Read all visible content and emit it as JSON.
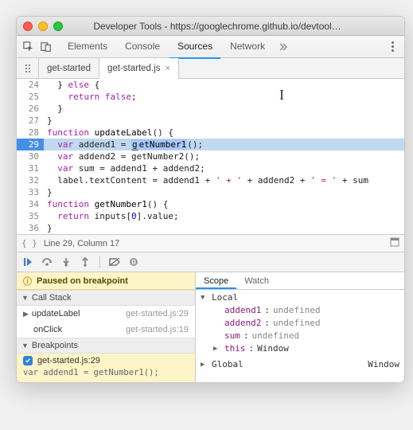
{
  "window": {
    "title": "Developer Tools - https://googlechrome.github.io/devtool…"
  },
  "panel_tabs": [
    "Elements",
    "Console",
    "Sources",
    "Network"
  ],
  "panel_active_index": 2,
  "file_tabs": [
    {
      "label": "get-started",
      "active": false
    },
    {
      "label": "get-started.js",
      "active": true
    }
  ],
  "code": {
    "first_line": 24,
    "current_line": 29,
    "lines": [
      {
        "n": 24,
        "html": "  } <span class='kw'>else</span> {"
      },
      {
        "n": 25,
        "html": "    <span class='kw'>return</span> <span class='kw'>false</span>;"
      },
      {
        "n": 26,
        "html": "  }"
      },
      {
        "n": 27,
        "html": "}"
      },
      {
        "n": 28,
        "html": "<span class='kw'>function</span> <span class='fn'>updateLabel</span>() {"
      },
      {
        "n": 29,
        "html": "  <span class='kw'>var</span> addend1 = <span class='selected underline'>g</span><span class='selected'>etNumber1</span>();"
      },
      {
        "n": 30,
        "html": "  <span class='kw'>var</span> addend2 = getNumber2();"
      },
      {
        "n": 31,
        "html": "  <span class='kw'>var</span> sum = addend1 + addend2;"
      },
      {
        "n": 32,
        "html": "  label.textContent = addend1 + <span class='str'>' + '</span> + addend2 + <span class='str'>' = '</span> + sum"
      },
      {
        "n": 33,
        "html": "}"
      },
      {
        "n": 34,
        "html": "<span class='kw'>function</span> <span class='fn'>getNumber1</span>() {"
      },
      {
        "n": 35,
        "html": "  <span class='kw'>return</span> inputs[<span class='num'>0</span>].value;"
      },
      {
        "n": 36,
        "html": "}"
      }
    ]
  },
  "status": {
    "text": "Line 29, Column 17"
  },
  "paused_label": "Paused on breakpoint",
  "call_stack": {
    "title": "Call Stack",
    "frames": [
      {
        "fn": "updateLabel",
        "loc": "get-started.js:29",
        "current": true
      },
      {
        "fn": "onClick",
        "loc": "get-started.js:19",
        "current": false
      }
    ]
  },
  "breakpoints": {
    "title": "Breakpoints",
    "items": [
      {
        "label": "get-started.js:29",
        "checked": true,
        "code": "var addend1 = getNumber1();"
      }
    ]
  },
  "scope": {
    "tabs": [
      "Scope",
      "Watch"
    ],
    "active_tab": 0,
    "local": {
      "label": "Local",
      "vars": [
        {
          "name": "addend1",
          "value": "undefined"
        },
        {
          "name": "addend2",
          "value": "undefined"
        },
        {
          "name": "sum",
          "value": "undefined"
        }
      ],
      "this": {
        "name": "this",
        "value": "Window"
      }
    },
    "global": {
      "label": "Global",
      "value": "Window"
    }
  }
}
